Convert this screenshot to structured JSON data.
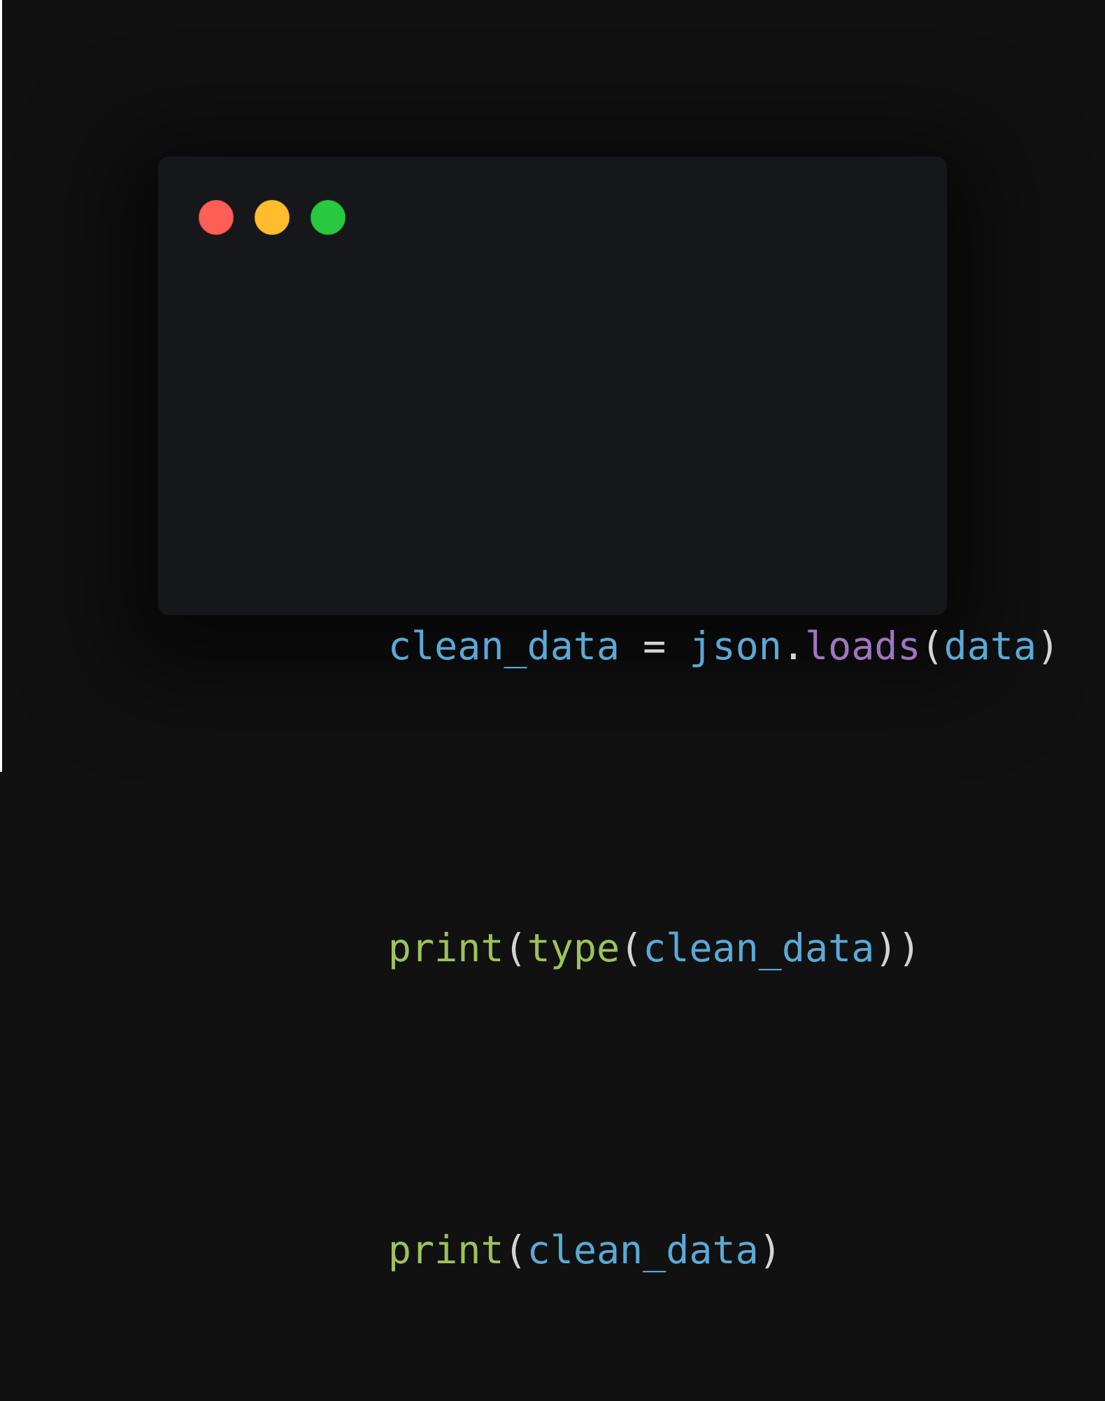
{
  "window": {
    "controls": {
      "close_color": "#ff5f56",
      "minimize_color": "#ffbd2e",
      "maximize_color": "#27c93f"
    }
  },
  "theme": {
    "background": "#111111",
    "panel": "#16171a",
    "variable_color": "#5aa9d6",
    "punctuation_color": "#d4d4d4",
    "builtin_function_color": "#9ec25a",
    "method_color": "#a274c2"
  },
  "code": {
    "lines": [
      {
        "tokens": [
          {
            "text": "clean_data",
            "kind": "var"
          },
          {
            "text": " = ",
            "kind": "punc"
          },
          {
            "text": "json",
            "kind": "var"
          },
          {
            "text": ".",
            "kind": "punc"
          },
          {
            "text": "loads",
            "kind": "method"
          },
          {
            "text": "(",
            "kind": "punc"
          },
          {
            "text": "data",
            "kind": "var"
          },
          {
            "text": ")",
            "kind": "punc"
          }
        ]
      },
      {
        "tokens": [
          {
            "text": "print",
            "kind": "func"
          },
          {
            "text": "(",
            "kind": "punc"
          },
          {
            "text": "type",
            "kind": "func"
          },
          {
            "text": "(",
            "kind": "punc"
          },
          {
            "text": "clean_data",
            "kind": "var"
          },
          {
            "text": "))",
            "kind": "punc"
          }
        ]
      },
      {
        "tokens": [
          {
            "text": "print",
            "kind": "func"
          },
          {
            "text": "(",
            "kind": "punc"
          },
          {
            "text": "clean_data",
            "kind": "var"
          },
          {
            "text": ")",
            "kind": "punc"
          }
        ]
      }
    ]
  }
}
